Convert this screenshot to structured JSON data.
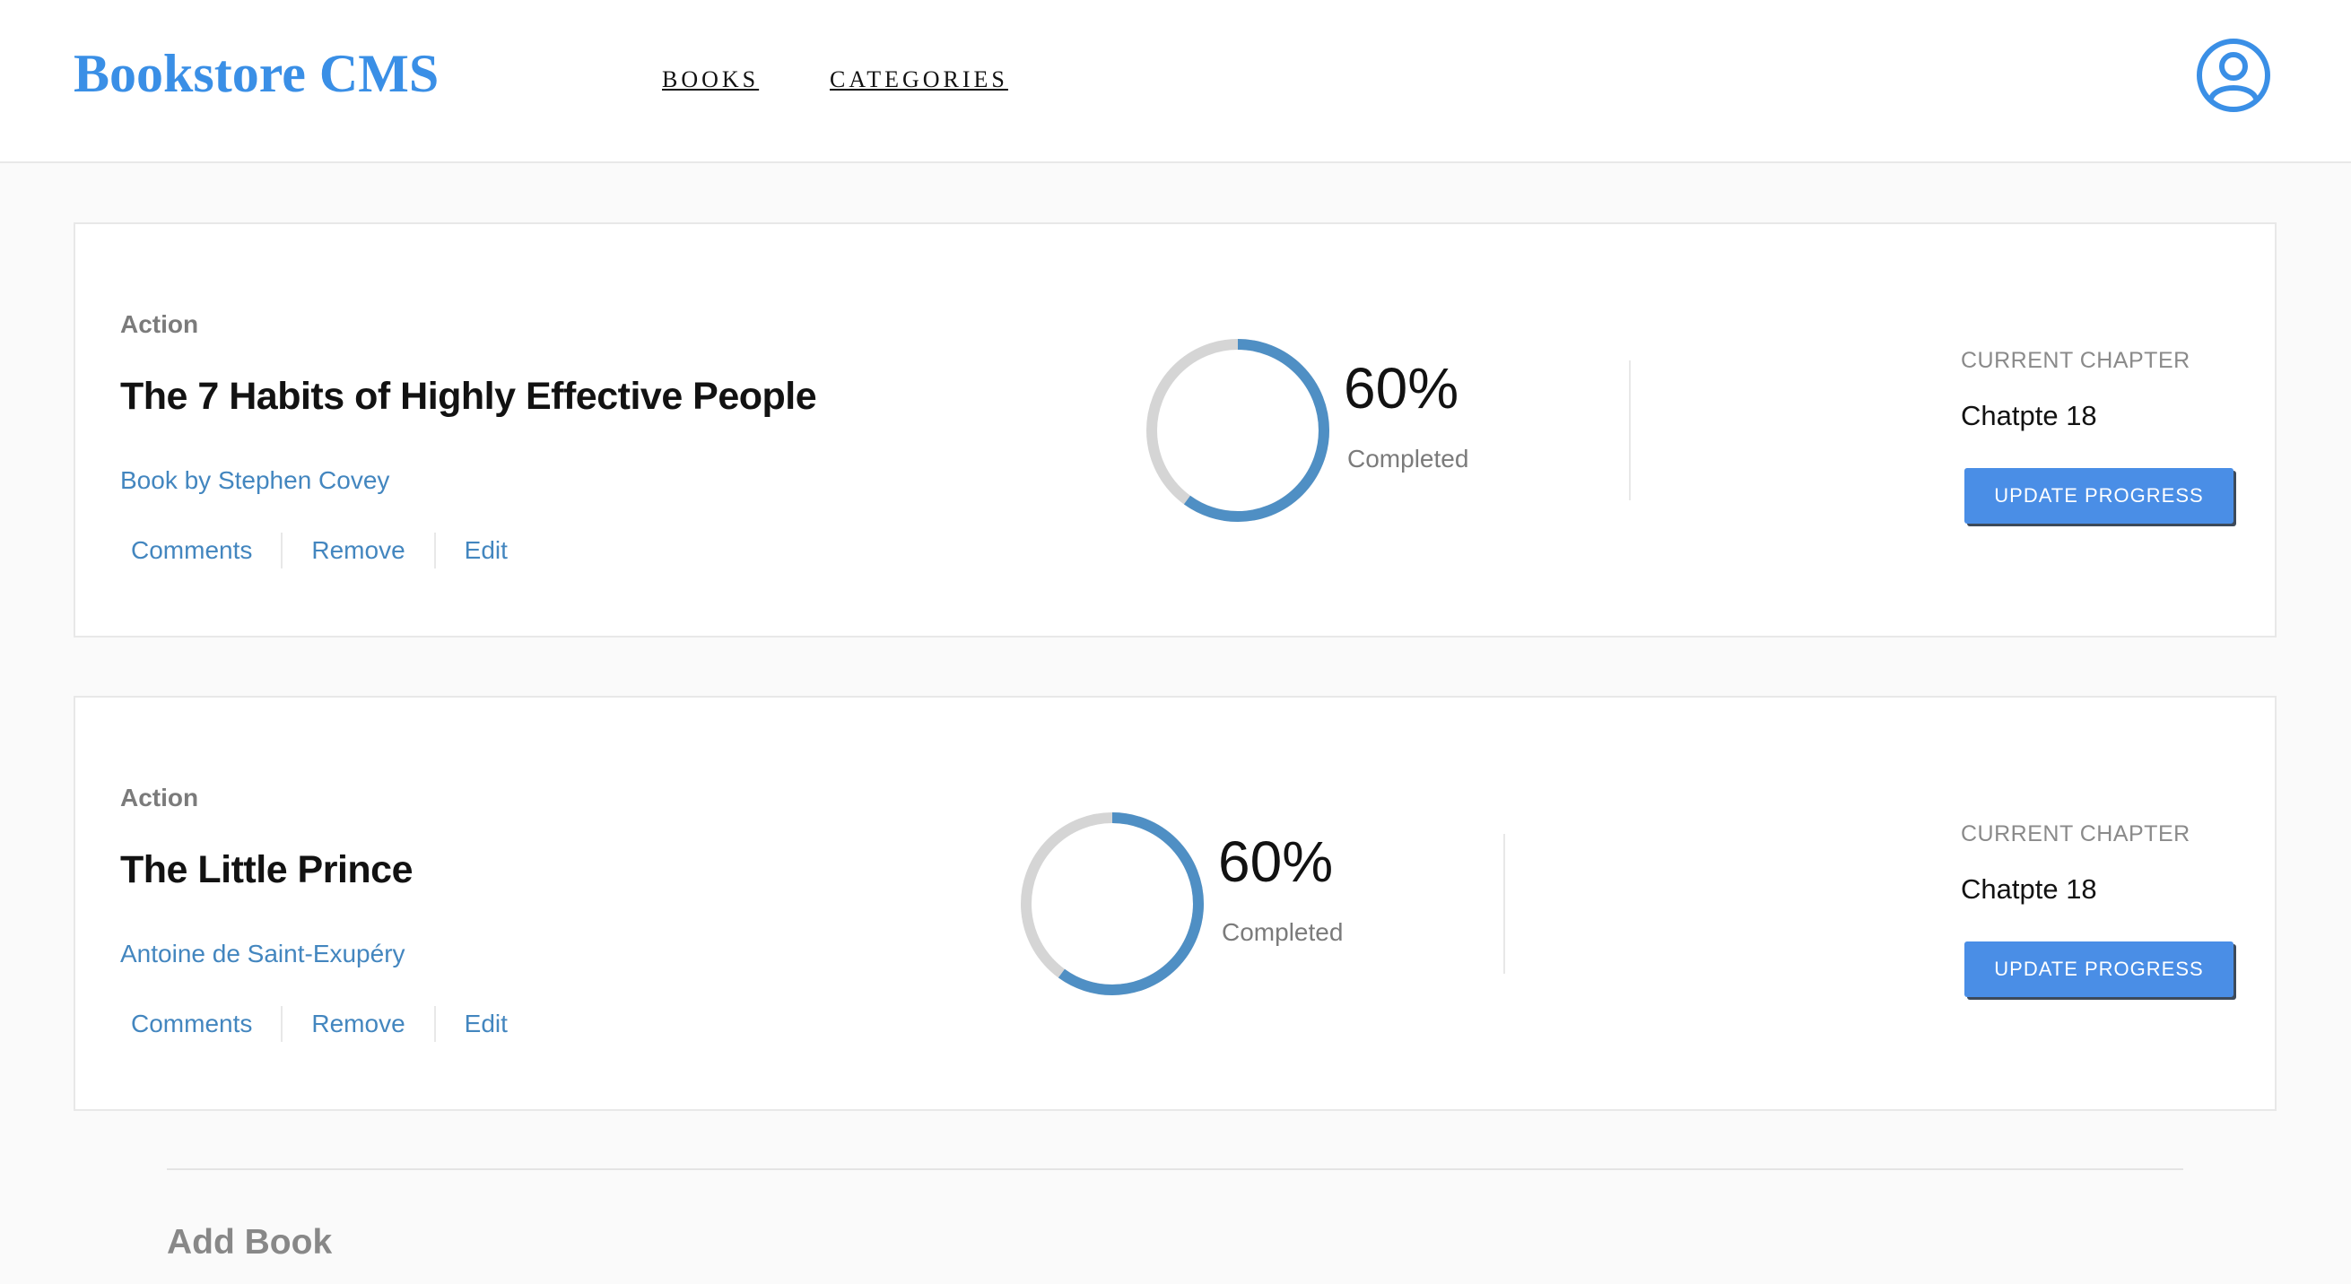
{
  "app": {
    "title": "Bookstore CMS",
    "accent_color": "#3a8fe6",
    "progress_color": "#4f8fc4"
  },
  "nav": {
    "books": "BOOKS",
    "categories": "CATEGORIES"
  },
  "user": {
    "icon": "user-circle-icon"
  },
  "books": [
    {
      "genre": "Action",
      "title": "The 7 Habits of Highly Effective People",
      "author": "Book by Stephen Covey",
      "actions": {
        "comments": "Comments",
        "remove": "Remove",
        "edit": "Edit"
      },
      "progress_percent": 60,
      "percent_text": "60%",
      "completed_label": "Completed",
      "chapter_label": "CURRENT CHAPTER",
      "chapter_value": "Chatpte 18",
      "update_button": "UPDATE PROGRESS"
    },
    {
      "genre": "Action",
      "title": "The Little Prince",
      "author": "Antoine de Saint-Exupéry",
      "actions": {
        "comments": "Comments",
        "remove": "Remove",
        "edit": "Edit"
      },
      "progress_percent": 60,
      "percent_text": "60%",
      "completed_label": "Completed",
      "chapter_label": "CURRENT CHAPTER",
      "chapter_value": "Chatpte 18",
      "update_button": "UPDATE PROGRESS"
    }
  ],
  "add_book": {
    "title": "Add Book"
  }
}
